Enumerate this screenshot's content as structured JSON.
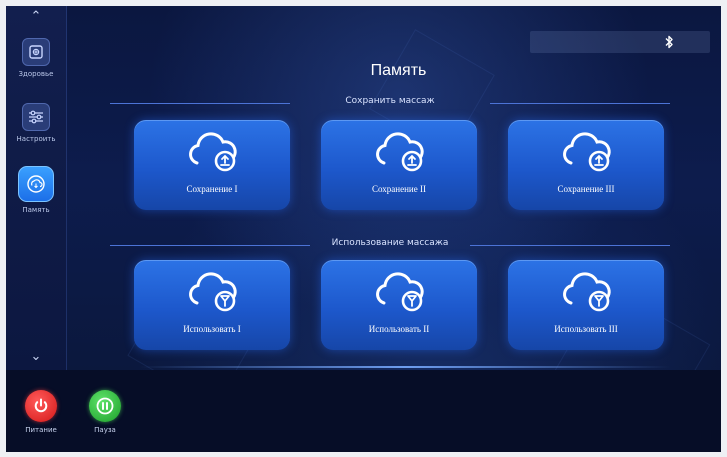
{
  "sidebar": {
    "items": [
      {
        "label": "Здоровье",
        "icon": "health-icon"
      },
      {
        "label": "Настроить",
        "icon": "sliders-icon"
      },
      {
        "label": "Память",
        "icon": "memory-icon",
        "active": true
      }
    ]
  },
  "footer": {
    "power_label": "Питание",
    "pause_label": "Пауза"
  },
  "header": {
    "title": "Память",
    "bluetooth_icon": "bluetooth-icon"
  },
  "save_section": {
    "heading": "Сохранить массаж",
    "buttons": [
      {
        "label": "Сохранение I",
        "icon": "cloud-upload-icon"
      },
      {
        "label": "Сохранение II",
        "icon": "cloud-upload-icon"
      },
      {
        "label": "Сохранение III",
        "icon": "cloud-upload-icon"
      }
    ]
  },
  "use_section": {
    "heading": "Использование массажа",
    "buttons": [
      {
        "label": "Использовать I",
        "icon": "cloud-download-icon"
      },
      {
        "label": "Использовать II",
        "icon": "cloud-download-icon"
      },
      {
        "label": "Использовать III",
        "icon": "cloud-download-icon"
      }
    ]
  },
  "colors": {
    "background": "#0d1c4d",
    "card": "#1d58cc",
    "power": "#d41818",
    "pause": "#1c9e2a"
  }
}
